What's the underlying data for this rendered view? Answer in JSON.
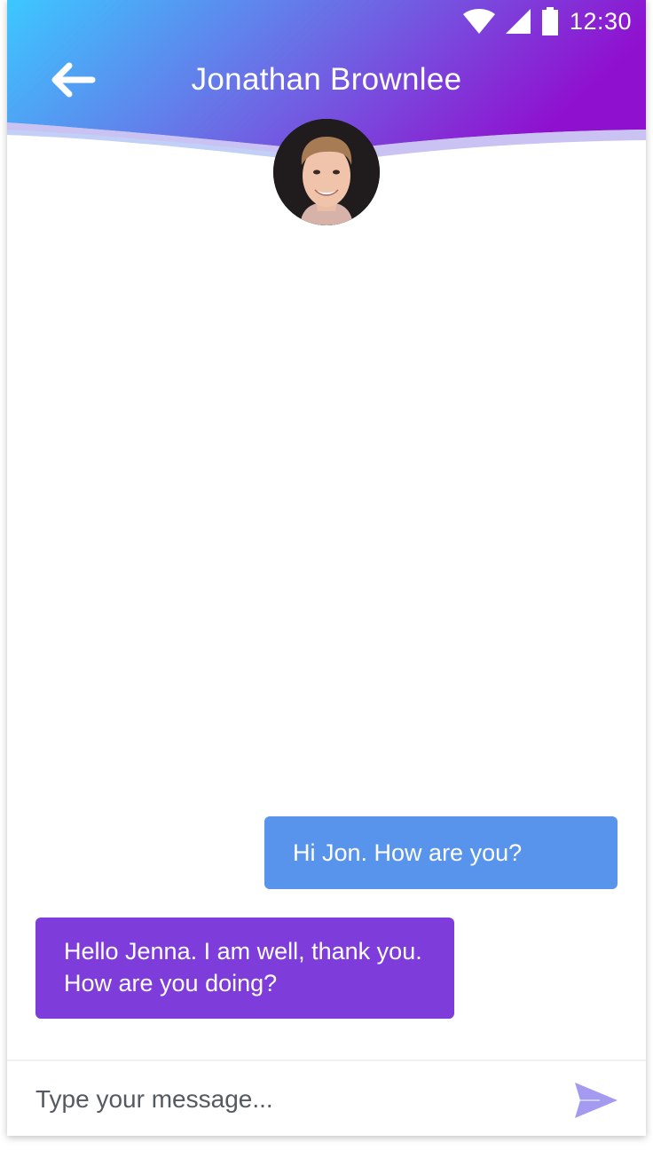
{
  "status_bar": {
    "time": "12:30",
    "icons": [
      "wifi-icon",
      "cellular-signal-icon",
      "battery-icon"
    ]
  },
  "header": {
    "back_icon": "arrow-left-icon",
    "contact_name": "Jonathan Brownlee",
    "gradient": [
      "#3cc8ff",
      "#6a6fe6",
      "#9010cf"
    ]
  },
  "messages": [
    {
      "direction": "sent",
      "text": "Hi Jon. How are you?",
      "color": "#5994ec"
    },
    {
      "direction": "received",
      "text": "Hello Jenna. I am well, thank you. How are you doing?",
      "color": "#7e3ddb"
    }
  ],
  "composer": {
    "placeholder": "Type your message...",
    "value": "",
    "send_icon": "send-icon",
    "send_color": "#a49bf0"
  }
}
